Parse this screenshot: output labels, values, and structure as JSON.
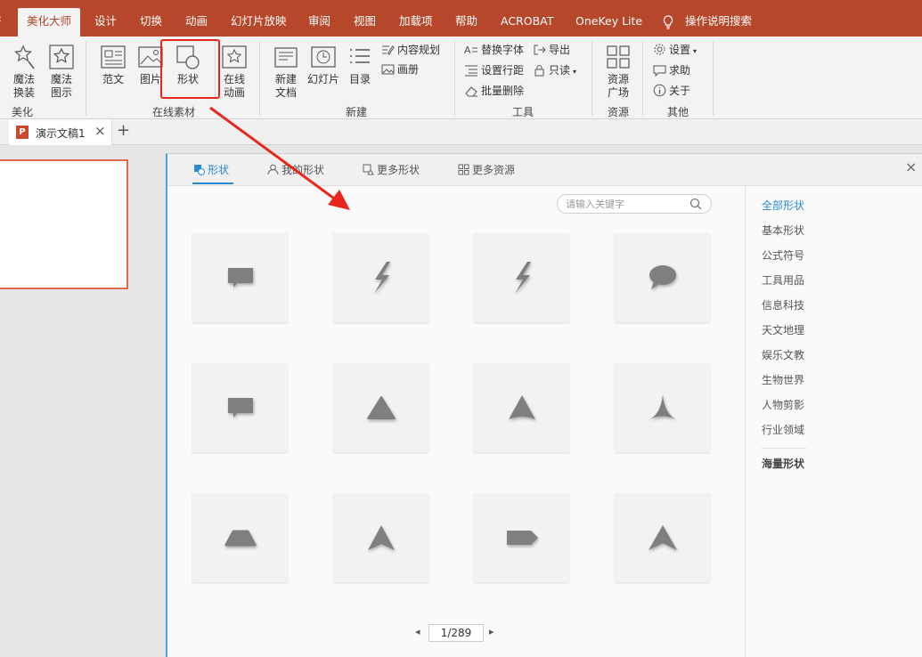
{
  "ribbon_tabs": [
    "美化大师",
    "设计",
    "切换",
    "动画",
    "幻灯片放映",
    "审阅",
    "视图",
    "加载项",
    "帮助",
    "ACROBAT",
    "OneKey Lite",
    "操作说明搜索"
  ],
  "ribbon": {
    "magic_replace": "魔法\n换装",
    "magic_chart": "魔法\n图示",
    "group_beautify": "美化",
    "template": "范文",
    "picture": "图片",
    "shape": "形状",
    "online_anim": "在线\n动画",
    "group_online": "在线素材",
    "new_doc": "新建\n文档",
    "slides": "幻灯片",
    "toc": "目录",
    "content_plan": "内容规划",
    "album": "画册",
    "group_new": "新建",
    "replace_font": "替换字体",
    "line_spacing": "设置行距",
    "batch_delete": "批量删除",
    "export": "导出",
    "read_only": "只读",
    "group_tools": "工具",
    "resource_square": "资源\n广场",
    "group_resource": "资源",
    "settings": "设置",
    "help": "求助",
    "about": "关于",
    "group_other": "其他"
  },
  "doc_tab": {
    "title": "演示文稿1",
    "close": "×",
    "add": "+"
  },
  "dialog": {
    "tabs": [
      "形状",
      "我的形状",
      "更多形状",
      "更多资源"
    ],
    "close": "×",
    "search_placeholder": "请输入关键字",
    "shapes": [
      "speech-rect-callout",
      "lightning-bolt",
      "lightning-bolt",
      "speech-oval-callout",
      "speech-rect-callout",
      "triangle",
      "curved-arrowhead",
      "concave-arrowhead",
      "rounded-trapezoid",
      "arrowhead",
      "pentagon-tag",
      "arrowhead"
    ],
    "shape_color": "#7f7f7f",
    "pagination": {
      "prev": "◂",
      "page": "1/289",
      "next": "▸"
    },
    "categories": [
      "全部形状",
      "基本形状",
      "公式符号",
      "工具用品",
      "信息科技",
      "天文地理",
      "娱乐文教",
      "生物世界",
      "人物剪影",
      "行业领域"
    ],
    "extra_category": "海量形状"
  },
  "colors": {
    "brand": "#b7472a",
    "accent": "#2a8ad4",
    "highlight": "#e8261d"
  }
}
